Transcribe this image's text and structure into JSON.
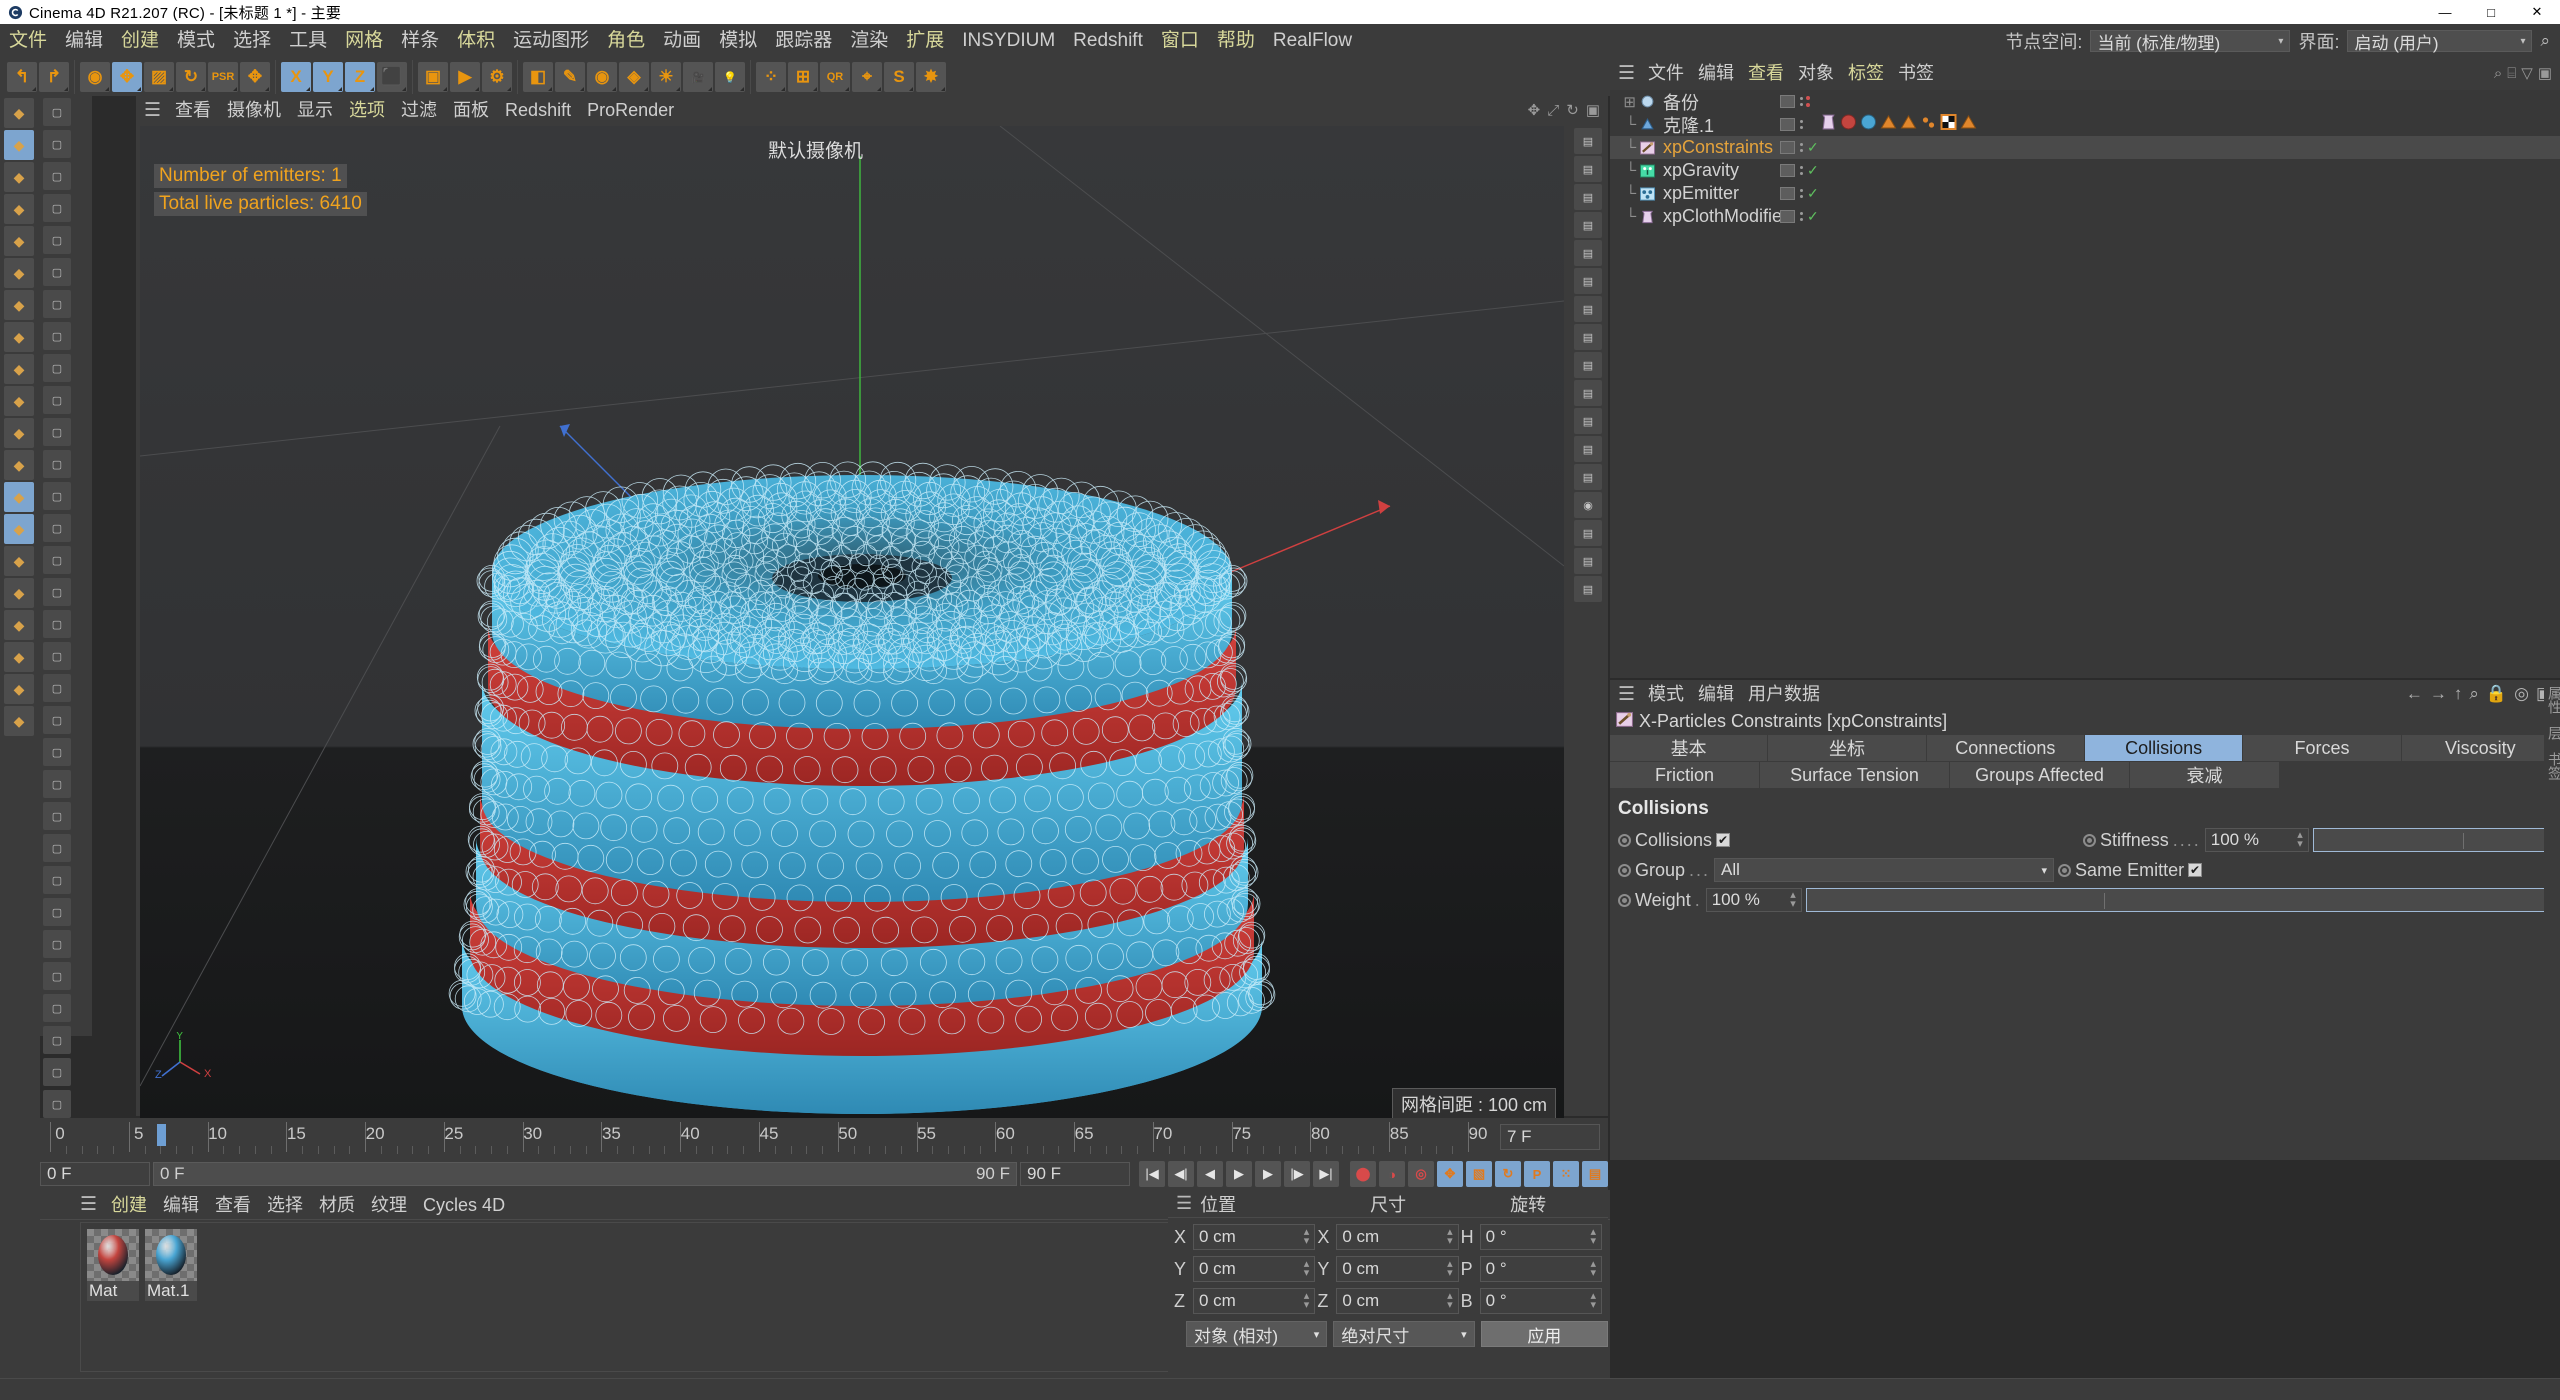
{
  "titlebar": {
    "title": "Cinema 4D R21.207 (RC) - [未标题 1 *] - 主要",
    "minimize": "—",
    "maximize": "□",
    "close": "✕",
    "app_icon": "cinema4d-logo-icon"
  },
  "menubar": {
    "items": [
      {
        "label": "文件",
        "color": "yellow"
      },
      {
        "label": "编辑",
        "color": "gray"
      },
      {
        "label": "创建",
        "color": "yellow"
      },
      {
        "label": "模式",
        "color": "gray"
      },
      {
        "label": "选择",
        "color": "gray"
      },
      {
        "label": "工具",
        "color": "gray"
      },
      {
        "label": "网格",
        "color": "yellow"
      },
      {
        "label": "样条",
        "color": "gray"
      },
      {
        "label": "体积",
        "color": "yellow"
      },
      {
        "label": "运动图形",
        "color": "gray"
      },
      {
        "label": "角色",
        "color": "yellow"
      },
      {
        "label": "动画",
        "color": "gray"
      },
      {
        "label": "模拟",
        "color": "gray"
      },
      {
        "label": "跟踪器",
        "color": "gray"
      },
      {
        "label": "渲染",
        "color": "gray"
      },
      {
        "label": "扩展",
        "color": "yellow"
      },
      {
        "label": "INSYDIUM",
        "color": "gray"
      },
      {
        "label": "Redshift",
        "color": "gray"
      },
      {
        "label": "窗口",
        "color": "yellow"
      },
      {
        "label": "帮助",
        "color": "yellow"
      },
      {
        "label": "RealFlow",
        "color": "gray"
      }
    ],
    "nodespace_label": "节点空间:",
    "nodespace_value": "当前 (标准/物理)",
    "layout_label": "界面:",
    "layout_value": "启动 (用户)",
    "search_icon": "search-icon"
  },
  "toolbar": {
    "groups": [
      {
        "buttons": [
          {
            "name": "undo-button",
            "glyph": "↰",
            "selected": false
          },
          {
            "name": "redo-button",
            "glyph": "↱",
            "selected": false
          }
        ]
      },
      {
        "buttons": [
          {
            "name": "live-selection-tool",
            "glyph": "◉",
            "selected": false
          },
          {
            "name": "move-tool",
            "glyph": "✥",
            "selected": true
          },
          {
            "name": "scale-tool",
            "glyph": "▨",
            "selected": false
          },
          {
            "name": "rotate-tool",
            "glyph": "↻",
            "selected": false
          },
          {
            "name": "psr-tool",
            "glyph": "PSR",
            "selected": false
          },
          {
            "name": "move-axis-tool",
            "glyph": "✥",
            "selected": false
          }
        ]
      },
      {
        "buttons": [
          {
            "name": "x-axis-lock-button",
            "glyph": "X",
            "selected": true
          },
          {
            "name": "y-axis-lock-button",
            "glyph": "Y",
            "selected": true
          },
          {
            "name": "z-axis-lock-button",
            "glyph": "Z",
            "selected": true
          },
          {
            "name": "world-object-coordinates-button",
            "glyph": "⬛",
            "selected": false
          }
        ]
      },
      {
        "buttons": [
          {
            "name": "render-view-button",
            "glyph": "▣",
            "selected": false
          },
          {
            "name": "render-to-picture-viewer-button",
            "glyph": "▶",
            "selected": false
          },
          {
            "name": "render-settings-button",
            "glyph": "⚙",
            "selected": false
          }
        ]
      },
      {
        "buttons": [
          {
            "name": "cube-primitive-button",
            "glyph": "◧",
            "selected": false
          },
          {
            "name": "spline-pen-button",
            "glyph": "✎",
            "selected": false
          },
          {
            "name": "generator-button",
            "glyph": "◉",
            "selected": false
          },
          {
            "name": "deformer-button",
            "glyph": "◈",
            "selected": false
          },
          {
            "name": "environment-button",
            "glyph": "☀",
            "selected": false
          },
          {
            "name": "camera-button",
            "glyph": "🎥",
            "selected": false
          },
          {
            "name": "light-button",
            "glyph": "💡",
            "selected": false
          }
        ]
      },
      {
        "buttons": [
          {
            "name": "mograph-button",
            "glyph": "⁘",
            "selected": false
          },
          {
            "name": "motion-tracker-button",
            "glyph": "⊞",
            "selected": false
          },
          {
            "name": "qr-button",
            "glyph": "QR",
            "selected": false
          },
          {
            "name": "joint-button",
            "glyph": "⌖",
            "selected": false
          },
          {
            "name": "insydium-button",
            "glyph": "S",
            "selected": false
          },
          {
            "name": "xparticles-button",
            "glyph": "✸",
            "selected": false
          }
        ]
      }
    ]
  },
  "viewport": {
    "menu": [
      {
        "label": "查看",
        "color": "gray"
      },
      {
        "label": "摄像机",
        "color": "gray"
      },
      {
        "label": "显示",
        "color": "gray"
      },
      {
        "label": "选项",
        "color": "yellow"
      },
      {
        "label": "过滤",
        "color": "gray"
      },
      {
        "label": "面板",
        "color": "gray"
      },
      {
        "label": "Redshift",
        "color": "gray"
      },
      {
        "label": "ProRender",
        "color": "gray"
      }
    ],
    "camera_label": "默认摄像机",
    "overlay_lines": [
      "Number of emitters: 1",
      "Total live particles: 6410"
    ],
    "overlay_color": "#f0a31e",
    "grid_spacing": "网格间距 : 100 cm",
    "axis_labels": [
      "Z",
      "Y",
      "X"
    ],
    "model": {
      "ring_color_blue": "#4cb8e8",
      "ring_color_red": "#c0302e",
      "wire_color": "#bfe8f7"
    }
  },
  "timeline": {
    "ticks": [
      0,
      5,
      10,
      15,
      20,
      25,
      30,
      35,
      40,
      45,
      50,
      55,
      60,
      65,
      70,
      75,
      80,
      85,
      90
    ],
    "current_frame_label": "7 F",
    "playhead_frame": 7,
    "range_min": 0,
    "range_max": 90
  },
  "transport": {
    "start_field": "0 F",
    "range_start": "0 F",
    "range_end": "90 F",
    "end_field": "90 F",
    "buttons": [
      {
        "name": "go-to-start-button",
        "glyph": "|◀"
      },
      {
        "name": "previous-key-button",
        "glyph": "◀|"
      },
      {
        "name": "step-back-button",
        "glyph": "◀"
      },
      {
        "name": "play-button",
        "glyph": "▶"
      },
      {
        "name": "step-forward-button",
        "glyph": "▶"
      },
      {
        "name": "next-key-button",
        "glyph": "|▶"
      },
      {
        "name": "go-to-end-button",
        "glyph": "▶|"
      }
    ],
    "record_buttons": [
      {
        "name": "record-active-objects-button",
        "glyph": "⬤",
        "selected": false
      },
      {
        "name": "autokeying-button",
        "glyph": "◑",
        "selected": false
      },
      {
        "name": "keyframe-selection-button",
        "glyph": "◎",
        "selected": false
      },
      {
        "name": "position-key-button",
        "glyph": "✥",
        "selected": true
      },
      {
        "name": "scale-key-button",
        "glyph": "▧",
        "selected": true
      },
      {
        "name": "rotation-key-button",
        "glyph": "↻",
        "selected": true
      },
      {
        "name": "parameter-key-button",
        "glyph": "P",
        "selected": true
      },
      {
        "name": "point-level-animation-button",
        "glyph": "⁙",
        "selected": true
      },
      {
        "name": "timeline-button",
        "glyph": "▤",
        "selected": true
      }
    ]
  },
  "materials": {
    "menu": [
      {
        "label": "创建",
        "color": "yellow"
      },
      {
        "label": "编辑",
        "color": "gray"
      },
      {
        "label": "查看",
        "color": "gray"
      },
      {
        "label": "选择",
        "color": "gray"
      },
      {
        "label": "材质",
        "color": "gray"
      },
      {
        "label": "纹理",
        "color": "gray"
      },
      {
        "label": "Cycles 4D",
        "color": "gray"
      }
    ],
    "items": [
      {
        "name": "Mat",
        "color": "#c4453f"
      },
      {
        "name": "Mat.1",
        "color": "#4aa6d4"
      }
    ]
  },
  "coordinates": {
    "headers": [
      "位置",
      "尺寸",
      "旋转"
    ],
    "rows": [
      {
        "pos_label": "X",
        "pos_value": "0 cm",
        "size_label": "X",
        "size_value": "0 cm",
        "rot_label": "H",
        "rot_value": "0 °"
      },
      {
        "pos_label": "Y",
        "pos_value": "0 cm",
        "size_label": "Y",
        "size_value": "0 cm",
        "rot_label": "P",
        "rot_value": "0 °"
      },
      {
        "pos_label": "Z",
        "pos_value": "0 cm",
        "size_label": "Z",
        "size_value": "0 cm",
        "rot_label": "B",
        "rot_value": "0 °"
      }
    ],
    "mode_dropdown": "对象 (相对)",
    "size_dropdown": "绝对尺寸",
    "apply_button": "应用"
  },
  "object_manager": {
    "menu": [
      {
        "label": "文件",
        "color": "gray"
      },
      {
        "label": "编辑",
        "color": "gray"
      },
      {
        "label": "查看",
        "color": "yellow"
      },
      {
        "label": "对象",
        "color": "gray"
      },
      {
        "label": "标签",
        "color": "yellow"
      },
      {
        "label": "书签",
        "color": "gray"
      }
    ],
    "objects": [
      {
        "name": "备份",
        "icon": "null-object-icon",
        "color": "gray",
        "expandable": true,
        "selected": false,
        "check": false,
        "tags": []
      },
      {
        "name": "克隆.1",
        "icon": "cloner-object-icon",
        "color": "gray",
        "expandable": false,
        "selected": false,
        "check": false,
        "tags": [
          "cloth-tag-icon",
          "material-red-icon",
          "material-blue-icon",
          "xp-tag-icon",
          "xp-tag2-icon",
          "particle-tag-icon",
          "checker-tag-icon",
          "xp-tag3-icon"
        ]
      },
      {
        "name": "xpConstraints",
        "icon": "xp-constraints-icon",
        "color": "orange",
        "expandable": false,
        "selected": true,
        "check": true,
        "tags": []
      },
      {
        "name": "xpGravity",
        "icon": "xp-gravity-icon",
        "color": "gray",
        "expandable": false,
        "selected": false,
        "check": true,
        "tags": []
      },
      {
        "name": "xpEmitter",
        "icon": "xp-emitter-icon",
        "color": "gray",
        "expandable": false,
        "selected": false,
        "check": true,
        "tags": []
      },
      {
        "name": "xpClothModifier",
        "icon": "xp-cloth-icon",
        "color": "gray",
        "expandable": false,
        "selected": false,
        "check": true,
        "tags": []
      }
    ]
  },
  "attribute_manager": {
    "menu": [
      {
        "label": "模式",
        "color": "gray"
      },
      {
        "label": "编辑",
        "color": "gray"
      },
      {
        "label": "用户数据",
        "color": "gray"
      }
    ],
    "title": "X-Particles Constraints [xpConstraints]",
    "title_icon": "xp-constraints-icon",
    "tabs_row1": [
      {
        "label": "基本",
        "active": false
      },
      {
        "label": "坐标",
        "active": false
      },
      {
        "label": "Connections",
        "active": false
      },
      {
        "label": "Collisions",
        "active": true
      },
      {
        "label": "Forces",
        "active": false
      },
      {
        "label": "Viscosity",
        "active": false
      }
    ],
    "tabs_row2": [
      {
        "label": "Friction",
        "active": false
      },
      {
        "label": "Surface Tension",
        "active": false
      },
      {
        "label": "Groups Affected",
        "active": false
      },
      {
        "label": "衰减",
        "active": false
      }
    ],
    "section_title": "Collisions",
    "fields": {
      "collisions_label": "Collisions",
      "collisions_checked": true,
      "stiffness_label": "Stiffness",
      "stiffness_value": "100 %",
      "group_label": "Group",
      "group_value": "All",
      "same_emitter_label": "Same Emitter",
      "same_emitter_checked": true,
      "weight_label": "Weight",
      "weight_value": "100 %"
    },
    "vertical_tabs": [
      "属性",
      "层",
      "书签"
    ]
  }
}
